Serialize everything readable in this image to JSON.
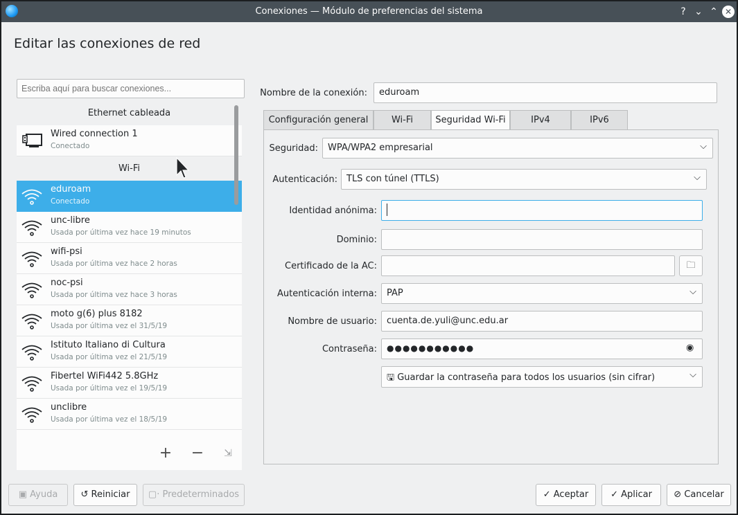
{
  "window": {
    "title": "Conexiones — Módulo de preferencias del sistema",
    "controls": {
      "help": "?",
      "minimize": "⌄",
      "maximize": "⌃",
      "close": "✕"
    }
  },
  "heading": "Editar las conexiones de red",
  "search": {
    "placeholder": "Escriba aquí para buscar conexiones..."
  },
  "sections": {
    "ethernet": "Ethernet cableada",
    "wifi": "Wi-Fi"
  },
  "ethernet_items": [
    {
      "name": "Wired connection 1",
      "status": "Conectado"
    }
  ],
  "wifi_items": [
    {
      "name": "eduroam",
      "status": "Conectado"
    },
    {
      "name": "unc-libre",
      "status": "Usada por última vez hace 19 minutos"
    },
    {
      "name": "wifi-psi",
      "status": "Usada por última vez hace 2 horas"
    },
    {
      "name": "noc-psi",
      "status": "Usada por última vez hace 3 horas"
    },
    {
      "name": "moto g(6) plus 8182",
      "status": "Usada por última vez el 31/5/19"
    },
    {
      "name": "Istituto Italiano di Cultura",
      "status": "Usada por última vez el 21/5/19"
    },
    {
      "name": "Fibertel WiFi442 5.8GHz",
      "status": "Usada por última vez el 19/5/19"
    },
    {
      "name": "unclibre",
      "status": "Usada por última vez el 18/5/19"
    }
  ],
  "list_toolbar": {
    "add": "+",
    "remove": "−",
    "export": "⇲"
  },
  "form": {
    "connection_name_label": "Nombre de la conexión:",
    "connection_name_value": "eduroam",
    "tabs": [
      "Configuración general",
      "Wi-Fi",
      "Seguridad Wi-Fi",
      "IPv4",
      "IPv6"
    ],
    "active_tab": "Seguridad Wi-Fi",
    "security_label": "Seguridad:",
    "security_value": "WPA/WPA2 empresarial",
    "auth_label": "Autenticación:",
    "auth_value": "TLS con túnel (TTLS)",
    "anon_identity_label": "Identidad anónima:",
    "anon_identity_value": "",
    "domain_label": "Dominio:",
    "domain_value": "",
    "ca_cert_label": "Certificado de la AC:",
    "ca_cert_value": "",
    "inner_auth_label": "Autenticación interna:",
    "inner_auth_value": "PAP",
    "username_label": "Nombre de usuario:",
    "username_value": "cuenta.de.yuli@unc.edu.ar",
    "password_label": "Contraseña:",
    "password_value": "●●●●●●●●●●●",
    "password_storage_value": "Guardar la contraseña para todos los usuarios (sin cifrar)"
  },
  "footer": {
    "help": "Ayuda",
    "reset": "Reiniciar",
    "defaults": "Predeterminados",
    "ok": "Aceptar",
    "apply": "Aplicar",
    "cancel": "Cancelar"
  },
  "colors": {
    "selection": "#3daee9",
    "titlebar": "#475057",
    "window_bg": "#eff0f1"
  }
}
